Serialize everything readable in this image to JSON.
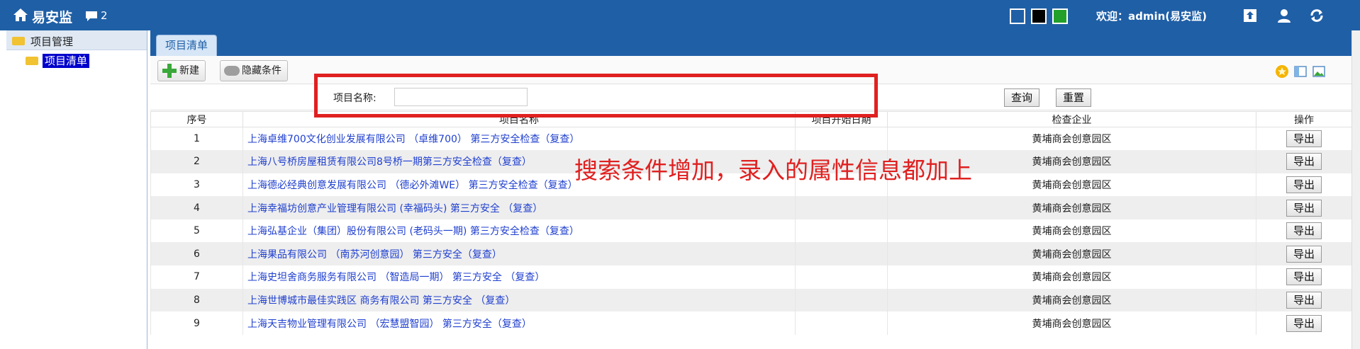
{
  "topbar": {
    "brand": "易安监",
    "message_count": "2",
    "welcome": "欢迎：admin(易安监)",
    "theme_swatches": [
      "#1f5fa6",
      "#000000",
      "#22a02a"
    ]
  },
  "sidebar": {
    "group_label": "项目管理",
    "item_label": "项目清单"
  },
  "tab": {
    "label": "项目清单"
  },
  "toolbar": {
    "new_label": "新建",
    "hide_label": "隐藏条件"
  },
  "search": {
    "field_label": "项目名称:",
    "input_value": "",
    "query_label": "查询",
    "reset_label": "重置"
  },
  "table": {
    "headers": [
      "序号",
      "项目名称",
      "项目开始日期",
      "检查企业",
      "操作"
    ],
    "rows": [
      {
        "no": "1",
        "name": "上海卓维700文化创业发展有限公司 （卓维700） 第三方安全检查（复查）",
        "start": "",
        "company": "黄埔商会创意园区",
        "op": "导出"
      },
      {
        "no": "2",
        "name": "上海八号桥房屋租赁有限公司8号桥一期第三方安全检查（复查）",
        "start": "",
        "company": "黄埔商会创意园区",
        "op": "导出"
      },
      {
        "no": "3",
        "name": "上海德必经典创意发展有限公司 （德必外滩WE） 第三方安全检查（复查）",
        "start": "",
        "company": "黄埔商会创意园区",
        "op": "导出"
      },
      {
        "no": "4",
        "name": "上海幸福坊创意产业管理有限公司 (幸福码头) 第三方安全 （复查）",
        "start": "",
        "company": "黄埔商会创意园区",
        "op": "导出"
      },
      {
        "no": "5",
        "name": "上海弘基企业（集团）股份有限公司 (老码头一期) 第三方安全检查（复查）",
        "start": "",
        "company": "黄埔商会创意园区",
        "op": "导出"
      },
      {
        "no": "6",
        "name": "上海果品有限公司 （南苏河创意园） 第三方安全（复查）",
        "start": "",
        "company": "黄埔商会创意园区",
        "op": "导出"
      },
      {
        "no": "7",
        "name": "上海史坦舍商务服务有限公司 （智造局一期） 第三方安全 （复查）",
        "start": "",
        "company": "黄埔商会创意园区",
        "op": "导出"
      },
      {
        "no": "8",
        "name": "上海世博城市最佳实践区 商务有限公司 第三方安全 （复查）",
        "start": "",
        "company": "黄埔商会创意园区",
        "op": "导出"
      },
      {
        "no": "9",
        "name": "上海天吉物业管理有限公司 （宏慧盟智园） 第三方安全（复查）",
        "start": "",
        "company": "黄埔商会创意园区",
        "op": "导出"
      }
    ]
  },
  "annotation": {
    "note": "搜索条件增加，录入的属性信息都加上",
    "color": "#e02020"
  }
}
